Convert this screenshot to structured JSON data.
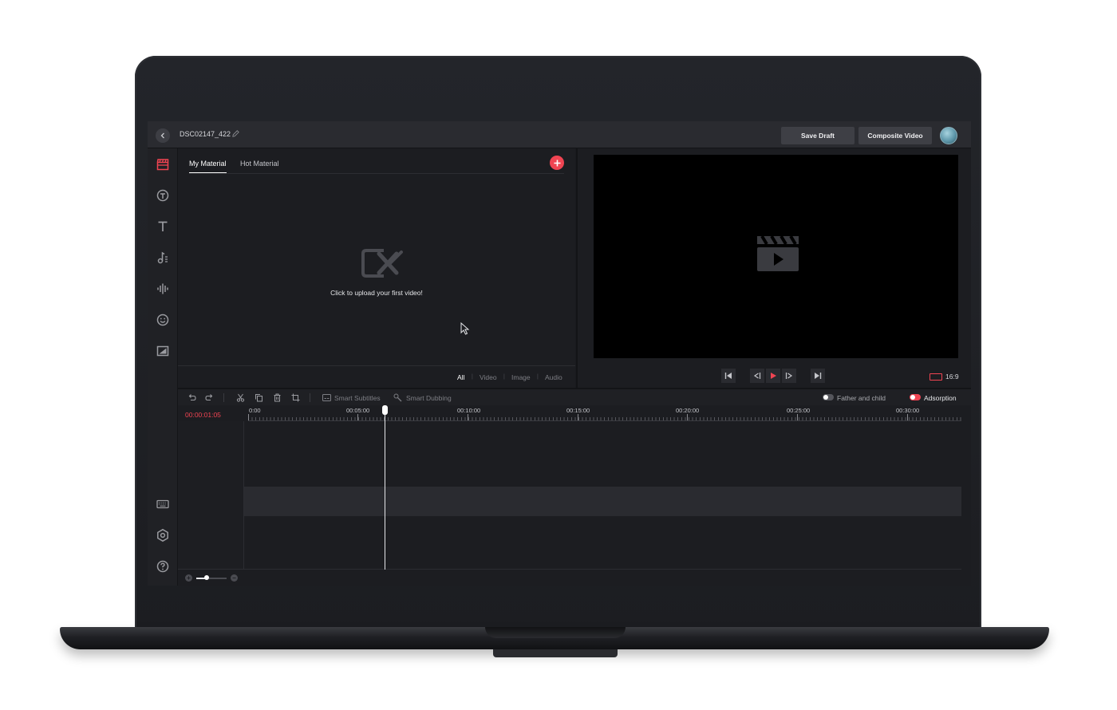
{
  "header": {
    "back_icon": "chevron-left-icon",
    "project_title": "DSC02147_422",
    "edit_icon": "pencil-icon",
    "save_draft_label": "Save Draft",
    "composite_video_label": "Composite Video",
    "avatar_icon": "user-avatar"
  },
  "sidebar": {
    "items": [
      {
        "icon": "clapperboard-icon",
        "active": true
      },
      {
        "icon": "sticker-icon",
        "active": false
      },
      {
        "icon": "text-icon",
        "active": false
      },
      {
        "icon": "music-icon",
        "active": false
      },
      {
        "icon": "audio-wave-icon",
        "active": false
      },
      {
        "icon": "emoji-icon",
        "active": false
      },
      {
        "icon": "image-filter-icon",
        "active": false
      }
    ],
    "bottom_items": [
      {
        "icon": "keyboard-icon"
      },
      {
        "icon": "settings-icon"
      },
      {
        "icon": "help-icon"
      }
    ]
  },
  "material": {
    "tabs": [
      {
        "label": "My Material",
        "active": true
      },
      {
        "label": "Hot Material",
        "active": false
      }
    ],
    "add_icon": "plus-icon",
    "upload_text": "Click to upload your first video!",
    "filters": [
      {
        "label": "All",
        "active": true
      },
      {
        "label": "Video",
        "active": false
      },
      {
        "label": "Image",
        "active": false
      },
      {
        "label": "Audio",
        "active": false
      }
    ]
  },
  "preview": {
    "placeholder_icon": "clapperboard-play-icon",
    "controls": [
      "skip-start-icon",
      "step-back-icon",
      "play-icon",
      "step-forward-icon",
      "skip-end-icon"
    ],
    "aspect_ratio": "16:9"
  },
  "timeline": {
    "toolbar": {
      "smart_subtitles_label": "Smart Subtitles",
      "smart_dubbing_label": "Smart Dubbing",
      "father_and_child_label": "Father and child",
      "father_and_child_enabled": false,
      "adsorption_label": "Adsorption",
      "adsorption_enabled": true
    },
    "current_time": "00:00:01:05",
    "ruler_labels": [
      "0:00",
      "00:05:00",
      "00:10:00",
      "00:15:00",
      "00:20:00",
      "00:25:00",
      "00:30:00"
    ],
    "zoom_level": 0.35
  },
  "colors": {
    "accent": "#f04452",
    "background": "#1a1b1f",
    "panel": "#1c1d21",
    "topbar": "#2a2b30"
  }
}
